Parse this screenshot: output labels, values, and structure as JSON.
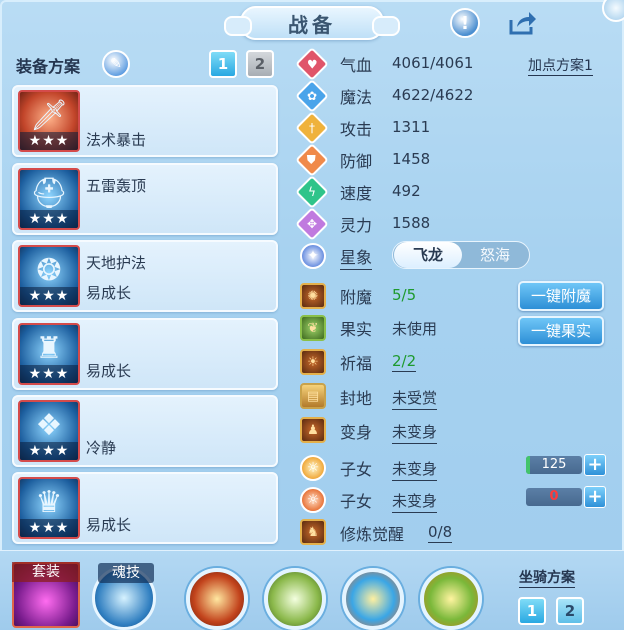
{
  "title": "战备",
  "icons": {
    "info": "exclamation-icon",
    "share": "share-icon",
    "edit": "pencil-icon"
  },
  "equipment": {
    "label": "装备方案",
    "tabs": [
      "1",
      "2"
    ],
    "active_tab": "1",
    "items": [
      {
        "name": "法术暴击",
        "stars": "★★★"
      },
      {
        "name": "五雷轰顶",
        "stars": "★★★"
      },
      {
        "name": "天地护法",
        "name2": "易成长",
        "stars": "★★★"
      },
      {
        "name": "易成长",
        "stars": "★★★"
      },
      {
        "name": "冷静",
        "stars": "★★★"
      },
      {
        "name": "易成长",
        "stars": "★★★"
      }
    ]
  },
  "stats": {
    "hp": {
      "label": "气血",
      "value": "4061/4061"
    },
    "mp": {
      "label": "魔法",
      "value": "4622/4622"
    },
    "atk": {
      "label": "攻击",
      "value": "1311"
    },
    "def": {
      "label": "防御",
      "value": "1458"
    },
    "spd": {
      "label": "速度",
      "value": "492"
    },
    "spirit": {
      "label": "灵力",
      "value": "1588"
    }
  },
  "points_plan": "加点方案1",
  "star": {
    "label": "星象",
    "options": [
      "飞龙",
      "怒海"
    ],
    "selected": "飞龙"
  },
  "enchant": {
    "label": "附魔",
    "value": "5/5",
    "button": "一键附魔"
  },
  "fruit": {
    "label": "果实",
    "value": "未使用",
    "button": "一键果实"
  },
  "bless": {
    "label": "祈福",
    "value": "2/2"
  },
  "fief": {
    "label": "封地",
    "value": "未受赏"
  },
  "transform": {
    "label": "变身",
    "value": "未变身"
  },
  "child1": {
    "label": "子女",
    "value": "未变身",
    "count": "125"
  },
  "child2": {
    "label": "子女",
    "value": "未变身",
    "count": "0"
  },
  "cultivation": {
    "label": "修炼觉醒",
    "value": "0/8"
  },
  "bottom": {
    "set_label": "套装",
    "soul_label": "魂技",
    "mount_label": "坐骑方案",
    "mount_tabs": [
      "1",
      "2"
    ]
  },
  "colors": {
    "accent": "#2d8fd6",
    "green": "#1e9a2e",
    "red": "#ff3b3b"
  }
}
